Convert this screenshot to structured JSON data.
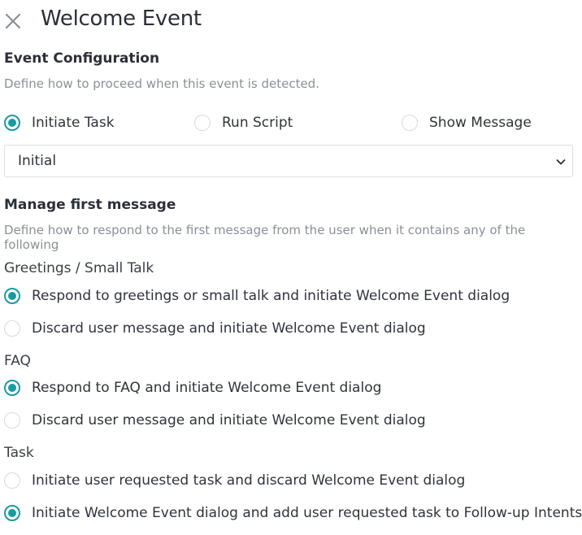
{
  "header": {
    "title": "Welcome Event",
    "close_icon": "close-icon"
  },
  "event_config": {
    "title": "Event Configuration",
    "description": "Define how to proceed when this event is detected.",
    "options": [
      {
        "label": "Initiate Task",
        "checked": true
      },
      {
        "label": "Run Script",
        "checked": false
      },
      {
        "label": "Show Message",
        "checked": false
      }
    ],
    "selected_task": "Initial"
  },
  "first_message": {
    "title": "Manage first message",
    "description": "Define how to respond to the first message from the user when it contains any of the following",
    "groups": [
      {
        "label": "Greetings / Small Talk",
        "options": [
          {
            "label": "Respond to greetings or small talk and initiate Welcome Event dialog",
            "checked": true
          },
          {
            "label": "Discard user message and initiate Welcome Event dialog",
            "checked": false
          }
        ]
      },
      {
        "label": "FAQ",
        "options": [
          {
            "label": "Respond to FAQ and initiate Welcome Event dialog",
            "checked": true
          },
          {
            "label": "Discard user message and initiate Welcome Event dialog",
            "checked": false
          }
        ]
      },
      {
        "label": "Task",
        "options": [
          {
            "label": "Initiate user requested task and discard Welcome Event dialog",
            "checked": false
          },
          {
            "label": "Initiate Welcome Event dialog and add user requested task to Follow-up Intents",
            "checked": true
          }
        ]
      }
    ]
  },
  "colors": {
    "accent": "#1a9ba3",
    "text": "#2f333b",
    "muted": "#8a8f98",
    "border": "#dcdee2"
  }
}
